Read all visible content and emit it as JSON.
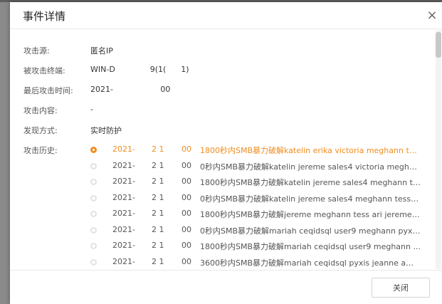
{
  "dialog": {
    "title": "事件详情",
    "close_icon": "close-icon",
    "close_button_label": "关闭"
  },
  "fields": [
    {
      "label": "攻击源:",
      "value": "匿名IP"
    },
    {
      "label": "被攻击终端:",
      "value": "WIN-D              9(1(      1)"
    },
    {
      "label": "最后攻击时间:",
      "value": "2021-                   00"
    },
    {
      "label": "攻击内容:",
      "value": "-"
    },
    {
      "label": "发现方式:",
      "value": "实时防护"
    },
    {
      "label": "攻击历史:"
    }
  ],
  "history": [
    {
      "date": "2021-",
      "mid": "2 1",
      "time": "00",
      "text": "1800秒内SMB暴力破解katelin erika victoria meghann tes...",
      "active": true
    },
    {
      "date": "2021-",
      "mid": "2 1",
      "time": "00",
      "text": "0秒内SMB暴力破解katelin jereme sales4 victoria megha...",
      "active": false
    },
    {
      "date": "2021-",
      "mid": "2 1",
      "time": "00",
      "text": "1800秒内SMB暴力破解katelin jereme sales4 meghann te...",
      "active": false
    },
    {
      "date": "2021-",
      "mid": "2 1",
      "time": "00",
      "text": "0秒内SMB暴力破解katelin jereme sales4 meghann tess j...",
      "active": false
    },
    {
      "date": "2021-",
      "mid": "2 1",
      "time": "00",
      "text": "1800秒内SMB暴力破解jereme meghann tess ari jeremey...",
      "active": false
    },
    {
      "date": "2021-",
      "mid": "2 1",
      "time": "00",
      "text": "0秒内SMB暴力破解mariah ceqidsql user9 meghann pyxi...",
      "active": false
    },
    {
      "date": "2021-",
      "mid": "2 1",
      "time": "00",
      "text": "1800秒内SMB暴力破解mariah ceqidsql user9 meghann ...",
      "active": false
    },
    {
      "date": "2021-",
      "mid": "2 1",
      "time": "00",
      "text": "3600秒内SMB暴力破解mariah ceqidsql pyxis jeanne ame...",
      "active": false
    }
  ],
  "colors": {
    "accent": "#f08c1e",
    "inactive_dot": "#e2e2e2"
  }
}
